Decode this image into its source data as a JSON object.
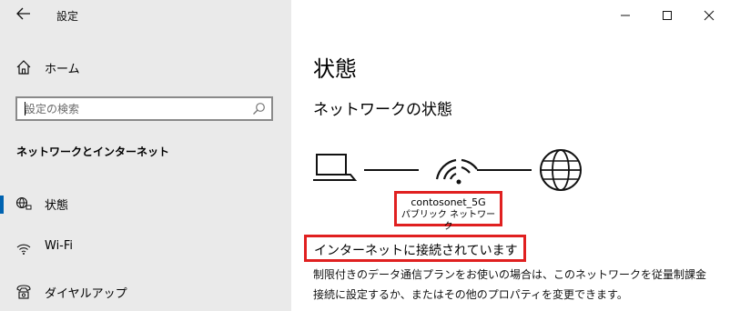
{
  "app": {
    "title": "設定",
    "back_label": "←"
  },
  "sidebar": {
    "home_label": "ホーム",
    "search_placeholder": "設定の検索",
    "section_heading": "ネットワークとインターネット",
    "items": [
      {
        "label": "状態",
        "icon": "status-icon",
        "selected": true
      },
      {
        "label": "Wi-Fi",
        "icon": "wifi-icon",
        "selected": false
      },
      {
        "label": "ダイヤルアップ",
        "icon": "dialup-icon",
        "selected": false
      }
    ]
  },
  "window": {
    "minimize": "minimize",
    "maximize": "maximize",
    "close": "close"
  },
  "main": {
    "title": "状態",
    "subtitle": "ネットワークの状態",
    "network_name": "contosonet_5G",
    "network_type": "パブリック ネットワーク",
    "connection_status": "インターネットに接続されています",
    "description": "制限付きのデータ通信プランをお使いの場合は、このネットワークを従量制課金接続に設定するか、またはその他のプロパティを変更できます。"
  },
  "colors": {
    "sidebar_bg": "#eaeaea",
    "accent": "#0063b1",
    "highlight": "#e02020"
  }
}
